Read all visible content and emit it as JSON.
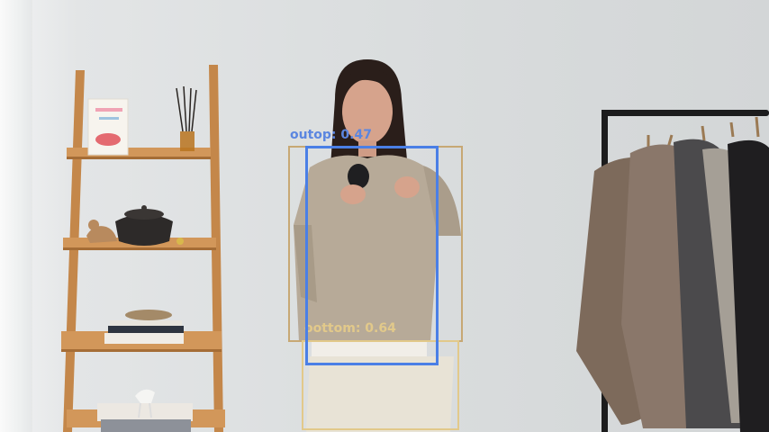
{
  "scene": {
    "description_icons": [
      "shelf-ladder",
      "person",
      "clothing-rack"
    ]
  },
  "detections": [
    {
      "label_text": "outop: 0.47",
      "color": "#c7a874"
    },
    {
      "label_text": "oottom: 0.64",
      "color": "#e2c98a"
    },
    {
      "label_text": "",
      "color": "#4a7fe6"
    }
  ],
  "colors": {
    "wall": "#d9dbdc",
    "wood": "#c78a4a",
    "sweater": "#b7aa98",
    "pants": "#e8e3d6",
    "hair": "#2a1e1a"
  }
}
